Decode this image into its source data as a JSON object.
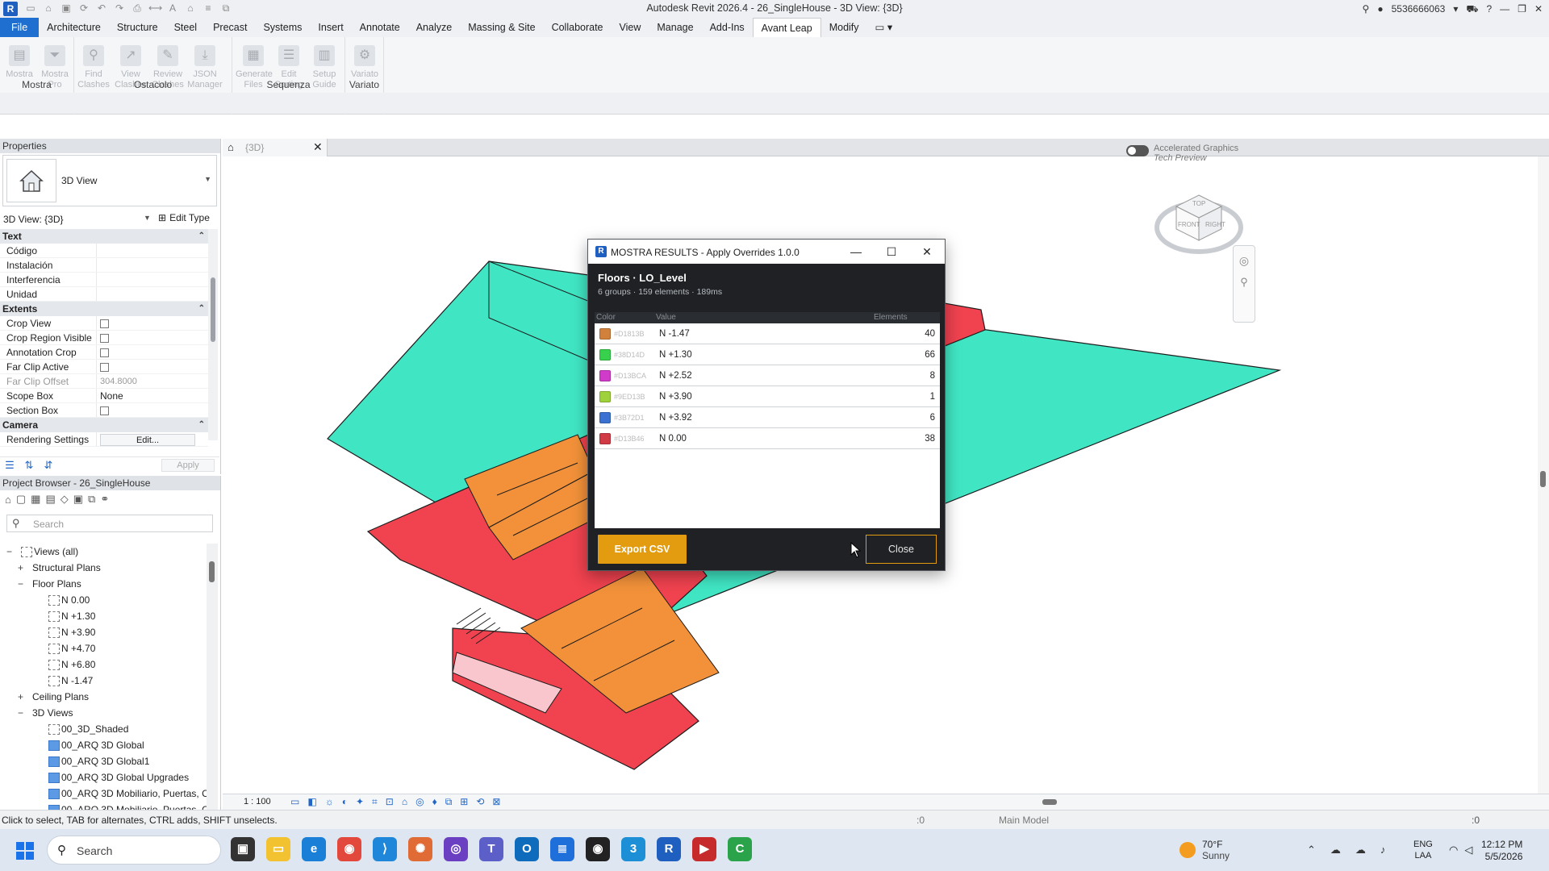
{
  "app": {
    "title": "Autodesk Revit 2026.4 - 26_SingleHouse - 3D View: {3D}",
    "user": "5536666063",
    "logo": "R"
  },
  "ribbon": {
    "tabs": [
      "File",
      "Architecture",
      "Structure",
      "Steel",
      "Precast",
      "Systems",
      "Insert",
      "Annotate",
      "Analyze",
      "Massing & Site",
      "Collaborate",
      "View",
      "Manage",
      "Add-Ins",
      "Avant Leap",
      "Modify"
    ],
    "active_tab": "Avant Leap",
    "groups": [
      {
        "label": "Mostra",
        "buttons": [
          "Mostra",
          "Mostra Pro"
        ]
      },
      {
        "label": "Ostacolo",
        "buttons": [
          "Find Clashes",
          "View Clashes",
          "Review Clashes",
          "JSON Manager"
        ]
      },
      {
        "label": "Sequenza",
        "buttons": [
          "Generate Files",
          "Edit Sorting",
          "Setup Guide"
        ]
      },
      {
        "label": "Variato",
        "buttons": [
          "Variato"
        ]
      }
    ]
  },
  "properties": {
    "header": "Properties",
    "type_name": "3D View",
    "selector": "3D View: {3D}",
    "edit_type": "Edit Type",
    "apply": "Apply",
    "categories": [
      {
        "name": "Text",
        "rows": [
          {
            "label": "Código",
            "value": ""
          },
          {
            "label": "Instalación",
            "value": ""
          },
          {
            "label": "Interferencia",
            "value": ""
          },
          {
            "label": "Unidad",
            "value": ""
          }
        ]
      },
      {
        "name": "Extents",
        "rows": [
          {
            "label": "Crop View",
            "value": "",
            "checkbox": true
          },
          {
            "label": "Crop Region Visible",
            "value": "",
            "checkbox": true
          },
          {
            "label": "Annotation Crop",
            "value": "",
            "checkbox": true
          },
          {
            "label": "Far Clip Active",
            "value": "",
            "checkbox": true
          },
          {
            "label": "Far Clip Offset",
            "value": "304.8000",
            "dim": true
          },
          {
            "label": "Scope Box",
            "value": "None"
          },
          {
            "label": "Section Box",
            "value": "",
            "checkbox": true
          }
        ]
      },
      {
        "name": "Camera",
        "rows": [
          {
            "label": "Rendering Settings",
            "value": "Edit...",
            "button": true
          }
        ]
      }
    ]
  },
  "browser": {
    "header": "Project Browser - 26_SingleHouse",
    "search_placeholder": "Search",
    "items": [
      {
        "label": "Views (all)",
        "level": 0,
        "toggle": "−",
        "kind": "views"
      },
      {
        "label": "Structural Plans",
        "level": 1,
        "toggle": "+"
      },
      {
        "label": "Floor Plans",
        "level": 1,
        "toggle": "−"
      },
      {
        "label": "N 0.00",
        "level": 2,
        "kind": "view"
      },
      {
        "label": "N +1.30",
        "level": 2,
        "kind": "view"
      },
      {
        "label": "N +3.90",
        "level": 2,
        "kind": "view"
      },
      {
        "label": "N +4.70",
        "level": 2,
        "kind": "view"
      },
      {
        "label": "N +6.80",
        "level": 2,
        "kind": "view"
      },
      {
        "label": "N -1.47",
        "level": 2,
        "kind": "view"
      },
      {
        "label": "Ceiling Plans",
        "level": 1,
        "toggle": "+"
      },
      {
        "label": "3D Views",
        "level": 1,
        "toggle": "−"
      },
      {
        "label": "00_3D_Shaded",
        "level": 2,
        "kind": "view"
      },
      {
        "label": "00_ARQ 3D Global",
        "level": 2,
        "kind": "view3d"
      },
      {
        "label": "00_ARQ 3D Global1",
        "level": 2,
        "kind": "view3d"
      },
      {
        "label": "00_ARQ 3D Global Upgrades",
        "level": 2,
        "kind": "view3d"
      },
      {
        "label": "00_ARQ 3D Mobiliario, Puertas, C",
        "level": 2,
        "kind": "view3d"
      },
      {
        "label": "00_ARQ 3D Mobiliario, Puertas, C",
        "level": 2,
        "kind": "view3d"
      }
    ]
  },
  "view": {
    "tab_label": "{3D}",
    "accelerated_line1": "Accelerated Graphics",
    "accelerated_line2": "Tech Preview",
    "viewcube_top": "TOP",
    "viewcube_front": "FRONT",
    "viewcube_right": "RIGHT",
    "scale": "1 : 100"
  },
  "dialog": {
    "title": "MOSTRA RESULTS - Apply Overrides  1.0.0",
    "category": "Floors",
    "parameter": "LO_Level",
    "summary": "6 groups  ·  159 elements  ·  189ms",
    "col_color": "Color",
    "col_value": "Value",
    "col_elements": "Elements",
    "rows": [
      {
        "color": "#D1813B",
        "value": "N -1.47",
        "count": "40"
      },
      {
        "color": "#38D14D",
        "value": "N +1.30",
        "count": "66"
      },
      {
        "color": "#D13BCA",
        "value": "N +2.52",
        "count": "8"
      },
      {
        "color": "#9ED13B",
        "value": "N +3.90",
        "count": "1"
      },
      {
        "color": "#3B72D1",
        "value": "N +3.92",
        "count": "6"
      },
      {
        "color": "#D13B46",
        "value": "N 0.00",
        "count": "38"
      }
    ],
    "export_label": "Export CSV",
    "close_label": "Close"
  },
  "status": {
    "message": "Click to select, TAB for alternates, CTRL adds, SHIFT unselects.",
    "zero": ":0",
    "model": "Main Model",
    "filter": ":0"
  },
  "taskbar": {
    "search_placeholder": "Search",
    "weather_temp": "70°F",
    "weather_desc": "Sunny",
    "lang1": "ENG",
    "lang2": "LAA",
    "time": "12:12 PM",
    "date": "5/5/2026"
  },
  "colors": {
    "accent": "#e39b0f",
    "file_tab": "#1f6fd1",
    "floor_teal": "#40e6c4",
    "floor_red": "#f0424f",
    "floor_orange": "#f2913a",
    "floor_lime": "#c3e83a"
  }
}
